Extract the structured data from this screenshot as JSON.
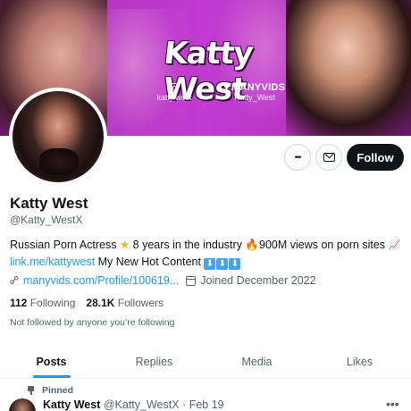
{
  "banner": {
    "title": "Katty West",
    "instagram_handle": "katty.west",
    "manyvids_brand": "MANYVIDS",
    "manyvids_user": "Katty_West",
    "colors": {
      "magenta": "#c23ad2",
      "dark_purple": "#6d1a74"
    }
  },
  "actions": {
    "more_label": "•••",
    "follow_label": "Follow",
    "icons": [
      "more-horizontal-icon",
      "mail-icon"
    ]
  },
  "profile": {
    "name": "Katty West",
    "handle": "@Katty_WestX",
    "bio_line1_a": "Russian Porn Actress ",
    "bio_star": "★",
    "bio_line1_b": " 8 years in the industry ",
    "bio_fire": "🔥",
    "bio_line1_c": "900M views on porn sites ",
    "bio_chart": "📈",
    "bio_link": "link.me/kattywest",
    "bio_line2": " My New Hot Content ",
    "bio_arrows": [
      "⬇",
      "⬇",
      "⬇"
    ],
    "website": "manyvids.com/Profile/100619...",
    "joined": "Joined December 2022"
  },
  "counts": {
    "following_value": "112",
    "following_label": "Following",
    "followers_value": "28.1K",
    "followers_label": "Followers"
  },
  "not_followed_text": "Not followed by anyone you’re following",
  "tabs": [
    {
      "label": "Posts",
      "active": true
    },
    {
      "label": "Replies",
      "active": false
    },
    {
      "label": "Media",
      "active": false
    },
    {
      "label": "Likes",
      "active": false
    }
  ],
  "pinned_post": {
    "pinned_label": "Pinned",
    "author": "Katty West",
    "handle": "@Katty_WestX",
    "separator": "·",
    "date": "Feb 19",
    "more_label": "•••"
  },
  "accent_color": "#1d9bf0"
}
